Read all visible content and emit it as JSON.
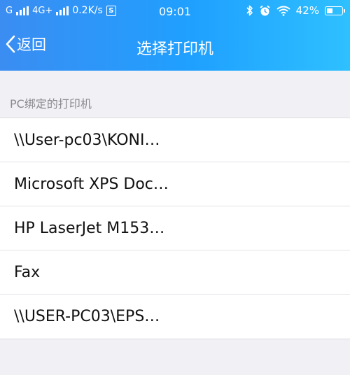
{
  "status_bar": {
    "carrier": "G",
    "network_type": "4G+",
    "speed": "0.2K/s",
    "speed_icon": "S",
    "time": "09:01",
    "battery_percent": "42%",
    "battery_level": 0.42,
    "icons": [
      "signal-icon",
      "bluetooth-icon",
      "alarm-icon",
      "wifi-icon",
      "battery-icon"
    ]
  },
  "nav": {
    "back_label": "返回",
    "title": "选择打印机"
  },
  "section": {
    "header": "PC绑定的打印机"
  },
  "printers": [
    "\\\\User-pc03\\KONI…",
    "Microsoft XPS Doc…",
    "HP LaserJet M153…",
    "Fax",
    "\\\\USER-PC03\\EPS…"
  ],
  "colors": {
    "header_gradient_start": "#3b8df2",
    "header_gradient_end": "#2ec0ff",
    "background": "#f0f0f5",
    "section_text": "#8a8a8f"
  }
}
